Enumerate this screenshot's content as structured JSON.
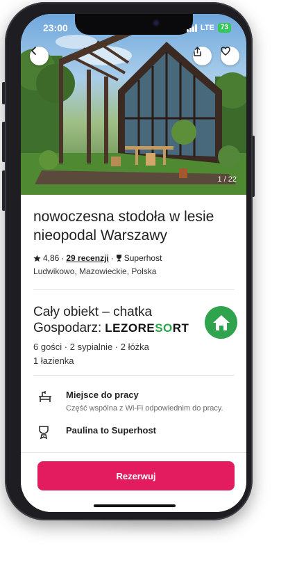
{
  "status_bar": {
    "time": "23:00",
    "network": "LTE",
    "battery": "73"
  },
  "hero": {
    "photo_counter": "1 / 22",
    "back_icon": "chevron-left-icon",
    "share_icon": "share-icon",
    "favorite_icon": "heart-icon"
  },
  "listing": {
    "title": "nowoczesna stodoła w lesie nieopodal Warszawy",
    "rating": "4,86",
    "separator": "·",
    "reviews_link": "29 recenzji",
    "superhost_label": "Superhost",
    "location": "Ludwikowo, Mazowieckie, Polska"
  },
  "host": {
    "property_type": "Cały obiekt – chatka",
    "host_prefix": "Gospodarz:",
    "brand_part1": "LEZORE",
    "brand_part2": "S",
    "brand_part3": "O",
    "brand_part4": "RT",
    "details_line1": "6 gości · 2 sypialnie · 2 łóżka",
    "details_line2": "1 łazienka"
  },
  "features": [
    {
      "icon": "workspace-icon",
      "title": "Miejsce do pracy",
      "description": "Część wspólna z Wi-Fi odpowiednim do pracy."
    },
    {
      "icon": "trophy-icon",
      "title": "Paulina to Superhost",
      "description": ""
    }
  ],
  "bottom_bar": {
    "reserve_label": "Rezerwuj"
  },
  "colors": {
    "accent": "#e31c5f",
    "host_green": "#2fa34d"
  }
}
